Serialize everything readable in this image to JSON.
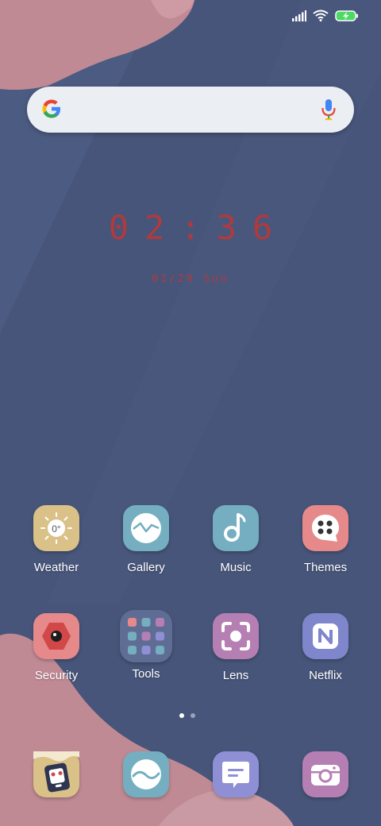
{
  "status_bar": {
    "icons": [
      "signal-icon",
      "wifi-icon",
      "battery-charging-icon"
    ],
    "accent": "#4cd964"
  },
  "search_bar": {
    "logo": "google-g-icon",
    "mic": "microphone-icon"
  },
  "clock": {
    "time": "02:36",
    "date": "01/29 Sun",
    "color": "#b03a3c"
  },
  "apps": [
    {
      "label": "Weather",
      "icon": "sun-icon",
      "color": "#d9c187",
      "temp": "0°"
    },
    {
      "label": "Gallery",
      "icon": "gallery-wave-icon",
      "color": "#74aec0"
    },
    {
      "label": "Music",
      "icon": "music-note-icon",
      "color": "#74aec0"
    },
    {
      "label": "Themes",
      "icon": "themes-palette-icon",
      "color": "#e5898a"
    },
    {
      "label": "Security",
      "icon": "security-shield-icon",
      "color": "#e5898a"
    },
    {
      "label": "Tools",
      "icon": "folder-icon",
      "color": "#5f6d94"
    },
    {
      "label": "Lens",
      "icon": "lens-scan-icon",
      "color": "#b57fb4"
    },
    {
      "label": "Netflix",
      "icon": "netflix-n-icon",
      "color": "#7f86cb"
    }
  ],
  "pager": {
    "pages": 2,
    "current": 1
  },
  "dock": [
    {
      "icon": "phone-icon",
      "color": "#d9c187"
    },
    {
      "icon": "browser-icon",
      "color": "#74aec0"
    },
    {
      "icon": "messages-icon",
      "color": "#8f8fd6"
    },
    {
      "icon": "camera-icon",
      "color": "#b57fb4"
    }
  ],
  "wallpaper": {
    "base": "#47557a",
    "blob": "#c08a95"
  }
}
